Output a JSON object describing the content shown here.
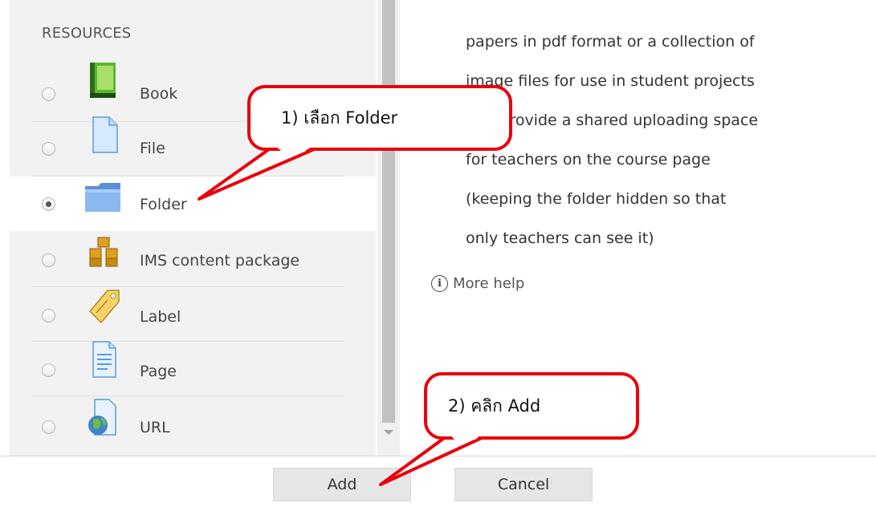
{
  "resources": {
    "heading": "RESOURCES",
    "items": [
      {
        "label": "Book",
        "icon": "book-icon",
        "selected": false
      },
      {
        "label": "File",
        "icon": "file-icon",
        "selected": false
      },
      {
        "label": "Folder",
        "icon": "folder-icon",
        "selected": true
      },
      {
        "label": "IMS content package",
        "icon": "ims-package-icon",
        "selected": false
      },
      {
        "label": "Label",
        "icon": "label-tag-icon",
        "selected": false
      },
      {
        "label": "Page",
        "icon": "page-icon",
        "selected": false
      },
      {
        "label": "URL",
        "icon": "url-globe-icon",
        "selected": false
      }
    ]
  },
  "description": {
    "lines": [
      "papers in pdf format or a collection of",
      "image files for use in student projects",
      "• to provide a shared uploading space",
      "for teachers on the course page",
      "(keeping the folder hidden so that",
      "only teachers can see it)"
    ],
    "more_help": "More help"
  },
  "footer": {
    "add_label": "Add",
    "cancel_label": "Cancel"
  },
  "annotations": {
    "step1": "1)   เลือก Folder",
    "step2": "2)  คลิก Add",
    "accent_color": "#e8000c"
  }
}
